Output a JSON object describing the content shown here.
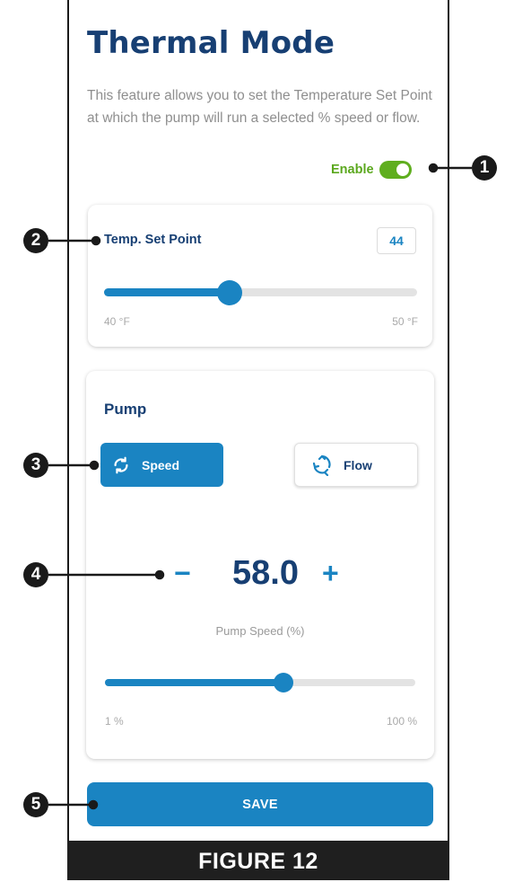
{
  "page": {
    "title": "Thermal Mode",
    "description": "This feature allows you to set the Temperature Set Point at which the pump will run a selected % speed or flow.",
    "enable": {
      "label": "Enable",
      "on": true
    },
    "colors": {
      "brand_navy": "#173f73",
      "accent_blue": "#1a84c2",
      "enable_green": "#5fae1f"
    }
  },
  "temp_set_point": {
    "label": "Temp. Set Point",
    "value": "44",
    "min_label": "40 °F",
    "max_label": "50 °F",
    "min": 40,
    "max": 50,
    "current": 44
  },
  "pump": {
    "title": "Pump",
    "modes": [
      {
        "label": "Speed",
        "icon": "rotate-arrows-icon",
        "selected": true
      },
      {
        "label": "Flow",
        "icon": "recycle-arrows-icon",
        "selected": false
      }
    ],
    "stepper": {
      "minus": "−",
      "value": "58.0",
      "plus": "+"
    },
    "caption": "Pump Speed (%)",
    "min_label": "1 %",
    "max_label": "100 %",
    "min": 1,
    "max": 100,
    "current": 58
  },
  "save_label": "SAVE",
  "figure_label": "FIGURE 12",
  "callouts": [
    "1",
    "2",
    "3",
    "4",
    "5"
  ]
}
